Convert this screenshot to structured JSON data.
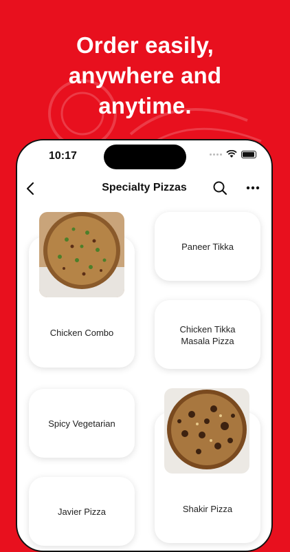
{
  "headline": {
    "line1": "Order easily,",
    "line2": "anywhere and",
    "line3": "anytime."
  },
  "status_bar": {
    "time": "10:17"
  },
  "nav": {
    "title": "Specialty Pizzas"
  },
  "products": [
    {
      "name": "Chicken Combo",
      "has_image": true
    },
    {
      "name": "Paneer Tikka",
      "has_image": false
    },
    {
      "name": "Chicken Tikka Masala Pizza",
      "has_image": false
    },
    {
      "name": "Spicy Vegetarian",
      "has_image": false
    },
    {
      "name": "Shakir Pizza",
      "has_image": true
    },
    {
      "name": "Javier Pizza",
      "has_image": false
    }
  ],
  "colors": {
    "brand_red": "#e8101e",
    "card_bg": "#ffffff",
    "text": "#222222"
  }
}
